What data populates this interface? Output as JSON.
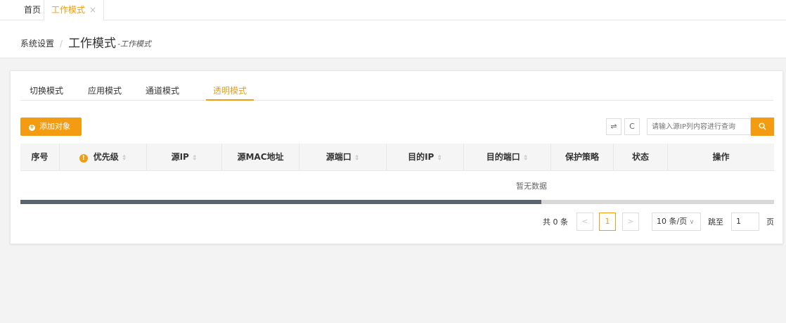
{
  "topbar": {
    "home": "首页",
    "active_tab": "工作模式",
    "close": "×"
  },
  "header": {
    "breadcrumb_parent": "系统设置",
    "separator": "/",
    "title": "工作模式",
    "subtitle": "-工作模式"
  },
  "tabs": [
    {
      "label": "切换模式",
      "active": false
    },
    {
      "label": "应用模式",
      "active": false
    },
    {
      "label": "通道模式",
      "active": false
    },
    {
      "label": "透明模式",
      "active": true
    }
  ],
  "toolbar": {
    "add_label": "添加对象",
    "add_icon": "+",
    "columns_icon": "⇌",
    "refresh_icon": "C",
    "search_placeholder": "请输入源IP列内容进行查询",
    "search_icon": "🔍"
  },
  "table": {
    "columns": [
      {
        "label": "序号",
        "sortable": false,
        "warn": false
      },
      {
        "label": "优先级",
        "sortable": true,
        "warn": true
      },
      {
        "label": "源IP",
        "sortable": true,
        "warn": false
      },
      {
        "label": "源MAC地址",
        "sortable": false,
        "warn": false
      },
      {
        "label": "源端口",
        "sortable": true,
        "warn": false
      },
      {
        "label": "目的IP",
        "sortable": true,
        "warn": false
      },
      {
        "label": "目的端口",
        "sortable": true,
        "warn": false
      },
      {
        "label": "保护策略",
        "sortable": false,
        "warn": false
      },
      {
        "label": "状态",
        "sortable": false,
        "warn": false
      },
      {
        "label": "操作",
        "sortable": false,
        "warn": false
      }
    ],
    "sort_glyph": "⇕",
    "warn_glyph": "!",
    "empty_text": "暂无数据",
    "horizontal_scroll_position": 0.69
  },
  "pagination": {
    "total": "共 0 条",
    "prev": "<",
    "current_page": "1",
    "next": ">",
    "page_size": "10 条/页",
    "page_size_caret": "∨",
    "jump_label": "跳至",
    "jump_value": "1",
    "page_suffix": "页"
  },
  "colors": {
    "accent": "#f39c12",
    "scroll_thumb": "#596570"
  }
}
